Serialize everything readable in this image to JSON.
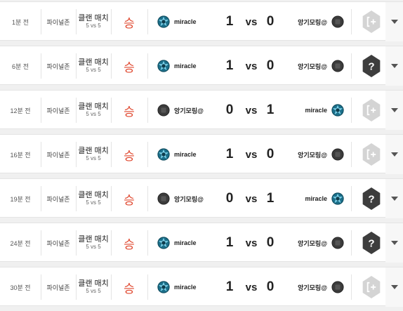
{
  "colors": {
    "win": "#e0482f",
    "hex_dark": "#3d3d3d",
    "hex_light": "#d4d4d4"
  },
  "labels": {
    "vs": "vs"
  },
  "matches": [
    {
      "time": "1분 전",
      "map": "파이널존",
      "mode": "클랜 매치",
      "mode_sub": "5 vs 5",
      "result": "승",
      "left_team": "miracle",
      "left_emblem": "miracle-emblem-icon",
      "left_score": "1",
      "right_score": "0",
      "right_team": "앙기모링@",
      "right_emblem": "dark-emblem-icon",
      "badge": "join-icon"
    },
    {
      "time": "6분 전",
      "map": "파이널존",
      "mode": "클랜 매치",
      "mode_sub": "5 vs 5",
      "result": "승",
      "left_team": "miracle",
      "left_emblem": "miracle-emblem-icon",
      "left_score": "1",
      "right_score": "0",
      "right_team": "앙기모링@",
      "right_emblem": "dark-emblem-icon",
      "badge": "question-icon"
    },
    {
      "time": "12분 전",
      "map": "파이널존",
      "mode": "클랜 매치",
      "mode_sub": "5 vs 5",
      "result": "승",
      "left_team": "앙기모링@",
      "left_emblem": "dark-emblem-icon",
      "left_score": "0",
      "right_score": "1",
      "right_team": "miracle",
      "right_emblem": "miracle-emblem-icon",
      "badge": "join-icon"
    },
    {
      "time": "16분 전",
      "map": "파이널존",
      "mode": "클랜 매치",
      "mode_sub": "5 vs 5",
      "result": "승",
      "left_team": "miracle",
      "left_emblem": "miracle-emblem-icon",
      "left_score": "1",
      "right_score": "0",
      "right_team": "앙기모링@",
      "right_emblem": "dark-emblem-icon",
      "badge": "join-icon"
    },
    {
      "time": "19분 전",
      "map": "파이널존",
      "mode": "클랜 매치",
      "mode_sub": "5 vs 5",
      "result": "승",
      "left_team": "앙기모링@",
      "left_emblem": "dark-emblem-icon",
      "left_score": "0",
      "right_score": "1",
      "right_team": "miracle",
      "right_emblem": "miracle-emblem-icon",
      "badge": "question-icon"
    },
    {
      "time": "24분 전",
      "map": "파이널존",
      "mode": "클랜 매치",
      "mode_sub": "5 vs 5",
      "result": "승",
      "left_team": "miracle",
      "left_emblem": "miracle-emblem-icon",
      "left_score": "1",
      "right_score": "0",
      "right_team": "앙기모링@",
      "right_emblem": "dark-emblem-icon",
      "badge": "question-icon"
    },
    {
      "time": "30분 전",
      "map": "파이널존",
      "mode": "클랜 매치",
      "mode_sub": "5 vs 5",
      "result": "승",
      "left_team": "miracle",
      "left_emblem": "miracle-emblem-icon",
      "left_score": "1",
      "right_score": "0",
      "right_team": "앙기모링@",
      "right_emblem": "dark-emblem-icon",
      "badge": "join-icon"
    }
  ]
}
